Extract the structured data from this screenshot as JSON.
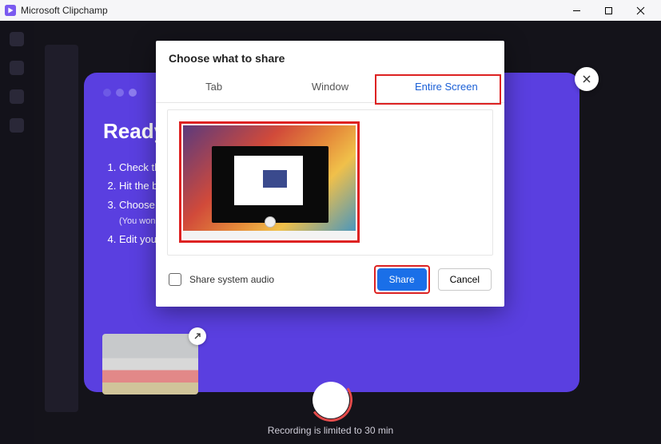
{
  "titlebar": {
    "app_name": "Microsoft Clipchamp"
  },
  "purple": {
    "heading": "Ready to",
    "items": [
      {
        "text": "Check the"
      },
      {
        "text": "Hit the bi"
      },
      {
        "text": "Choose a",
        "sub": "(You won't"
      },
      {
        "text": "Edit your"
      }
    ]
  },
  "dialog": {
    "title": "Choose what to share",
    "tabs": {
      "tab": "Tab",
      "window": "Window",
      "entire": "Entire Screen"
    },
    "share_audio": "Share system audio",
    "share": "Share",
    "cancel": "Cancel"
  },
  "recording_limit": "Recording is limited to 30 min"
}
